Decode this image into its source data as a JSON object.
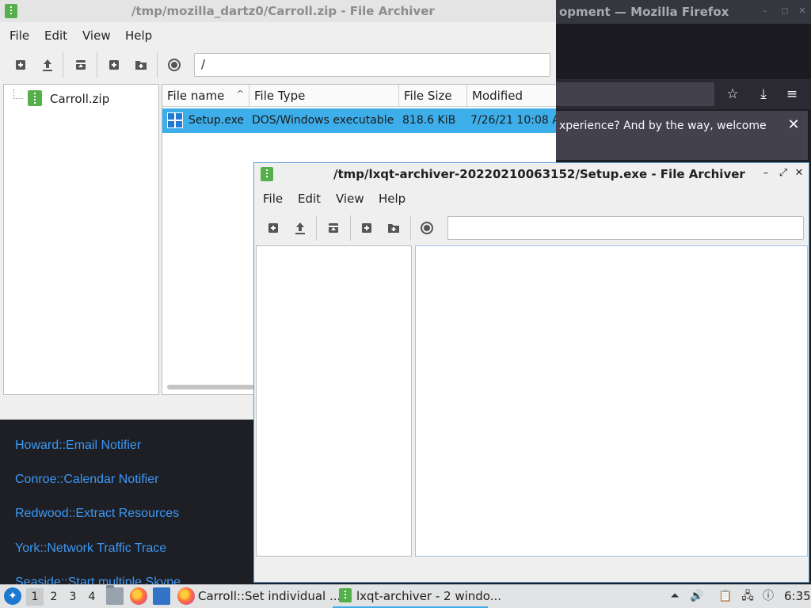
{
  "firefox": {
    "title": "opment — Mozilla Firefox",
    "notification_text": "xperience? And by the way, welcome",
    "nav_icons": [
      "star-icon",
      "download-icon",
      "hamburger-menu-icon"
    ],
    "links": [
      "Howard::Email Notifier",
      "Conroe::Calendar Notifier",
      "Redwood::Extract Resources",
      "York::Network Traffic Trace",
      "Seaside::Start multiple Skype"
    ]
  },
  "archiver1": {
    "title": "/tmp/mozilla_dartz0/Carroll.zip - File Archiver",
    "menu": [
      "File",
      "Edit",
      "View",
      "Help"
    ],
    "path": "/",
    "tree_item": "Carroll.zip",
    "columns": [
      "File name",
      "File Type",
      "File Size",
      "Modified"
    ],
    "sort_indicator": "^",
    "rows": [
      {
        "name": "Setup.exe",
        "type": "DOS/Windows executable",
        "size": "818.6 KiB",
        "modified": "7/26/21 10:08 A"
      }
    ]
  },
  "archiver2": {
    "title": "/tmp/lxqt-archiver-20220210063152/Setup.exe - File Archiver",
    "menu": [
      "File",
      "Edit",
      "View",
      "Help"
    ],
    "path": ""
  },
  "taskbar": {
    "desktops": [
      "1",
      "2",
      "3",
      "4"
    ],
    "active_desktop": "1",
    "tasks": [
      {
        "label": "Carroll::Set individual ..."
      },
      {
        "label": "lxqt-archiver - 2 windo..."
      }
    ],
    "clock": "6:35"
  },
  "colors": {
    "selection": "#3daee9",
    "link": "#3d97f5",
    "active_border": "#5c9bd6"
  }
}
